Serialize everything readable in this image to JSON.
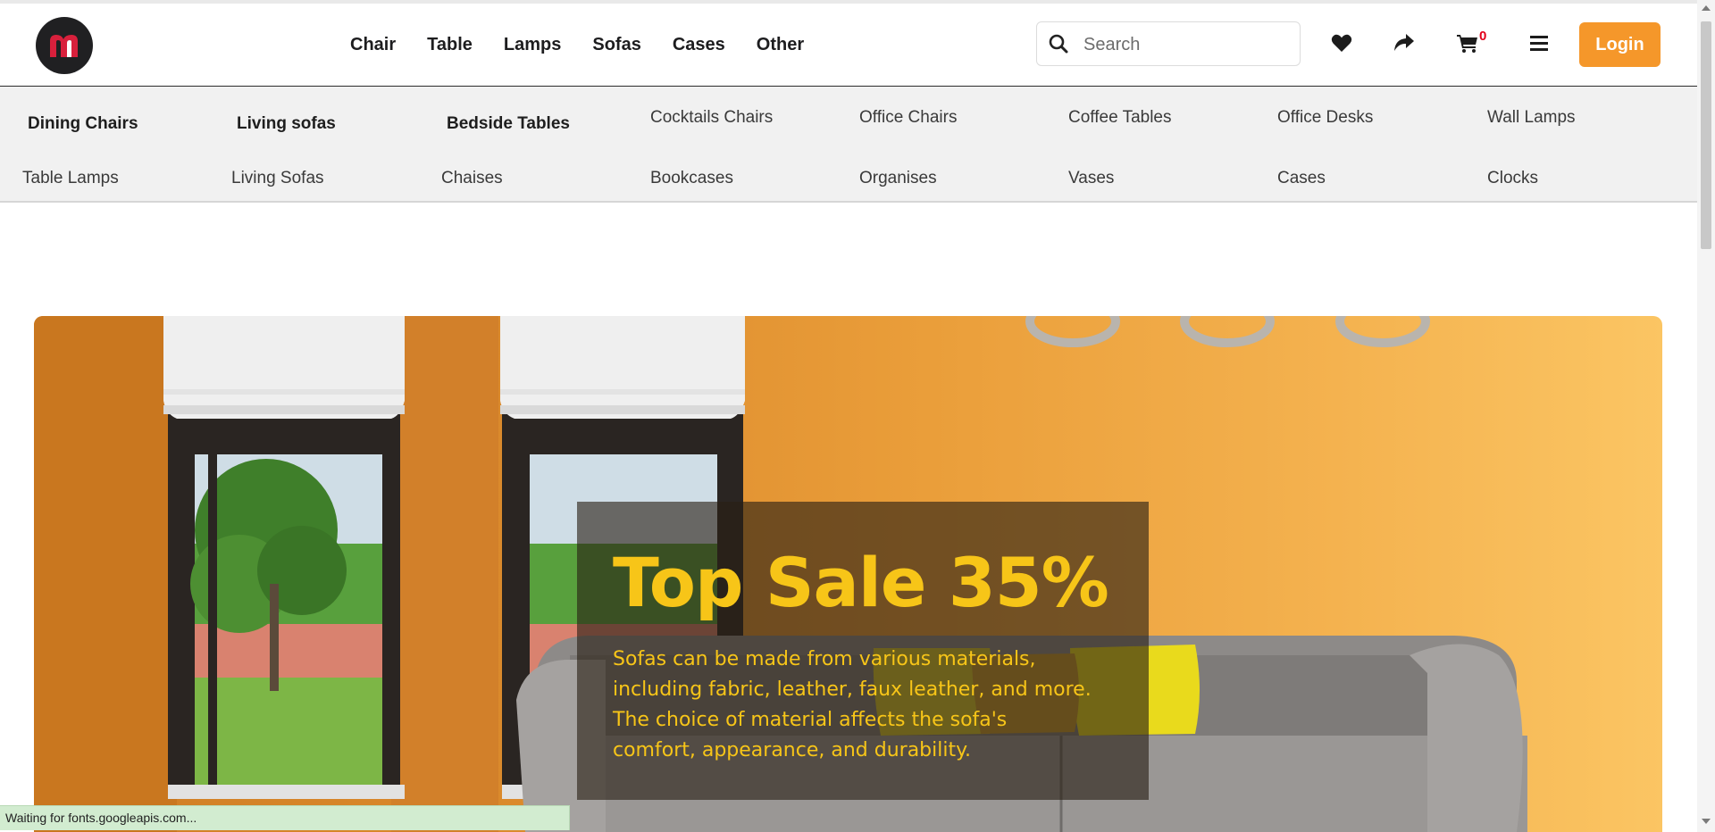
{
  "header": {
    "logo_letter": "m",
    "nav": [
      "Chair",
      "Table",
      "Lamps",
      "Sofas",
      "Cases",
      "Other"
    ],
    "search": {
      "placeholder": "Search",
      "value": ""
    },
    "icons": [
      "heart-icon",
      "share-icon",
      "cart-icon",
      "menu-icon"
    ],
    "cart_count": "0",
    "login_label": "Login"
  },
  "categories": {
    "row1": [
      "Dining Chairs",
      "Living sofas",
      "Bedside Tables",
      "Cocktails Chairs",
      "Office Chairs",
      "Coffee Tables",
      "Office Desks",
      "Wall Lamps"
    ],
    "row2": [
      "Table Lamps",
      "Living Sofas",
      "Chaises",
      "Bookcases",
      "Organises",
      "Vases",
      "Cases",
      "Clocks"
    ]
  },
  "hero": {
    "title": "Top Sale 35%",
    "text": "Sofas can be made from various materials, including fabric, leather, faux leather, and more. The choice of material affects the sofa's comfort, appearance, and durability."
  },
  "status_text": "Waiting for fonts.googleapis.com...",
  "colors": {
    "accent": "#f5972a",
    "hero_text": "#f7c518",
    "badge": "#e2001a",
    "logo_bg": "#202022",
    "logo_mark": "#d8203c"
  }
}
